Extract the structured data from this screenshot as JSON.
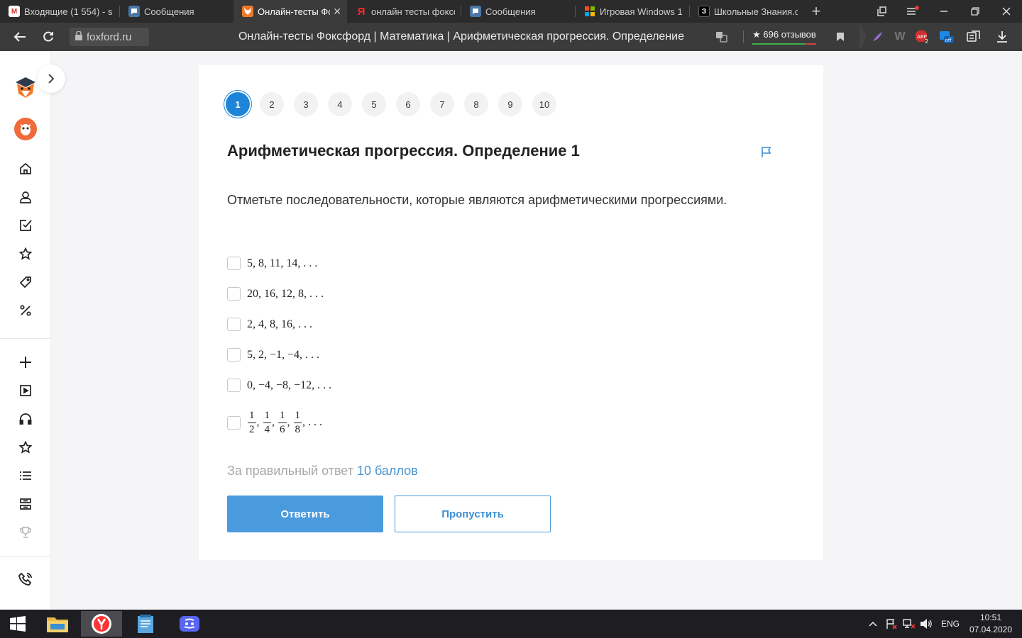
{
  "browser": {
    "tabs": [
      {
        "title": "Входящие (1 554) - s",
        "favicon": "gmail-icon",
        "color": "#d93025",
        "glyph": "M",
        "active": false
      },
      {
        "title": "Сообщения",
        "favicon": "vk-messages-icon",
        "color": "#4a76a8",
        "glyph": "",
        "active": false
      },
      {
        "title": "Онлайн-тесты Фо",
        "favicon": "foxford-icon",
        "color": "#f07a2c",
        "glyph": "",
        "active": true
      },
      {
        "title": "онлайн тесты фоксф",
        "favicon": "yandex-icon",
        "color": "#3b3b3b",
        "glyph": "Я",
        "active": false
      },
      {
        "title": "Сообщения",
        "favicon": "vk-messages-icon",
        "color": "#4a76a8",
        "glyph": "",
        "active": false
      },
      {
        "title": "Игровая Windows 1",
        "favicon": "microsoft-icon",
        "color": "#3b3b3b",
        "glyph": "",
        "active": false
      },
      {
        "title": "Школьные Знания.c",
        "favicon": "znanija-icon",
        "color": "#111111",
        "glyph": "З",
        "active": false
      }
    ],
    "url": "foxford.ru",
    "page_title": "Онлайн-тесты Фоксфорд | Математика | Арифметическая прогрессия. Определение",
    "reviews": "★ 696 отзывов"
  },
  "sidebar": {
    "items": [
      "home-icon",
      "profile-icon",
      "tasks-icon",
      "favorites-icon",
      "tag-icon",
      "discount-icon",
      "add-icon",
      "video-icon",
      "headphones-icon",
      "star-icon",
      "list-icon",
      "archive-icon",
      "trophy-icon",
      "phone-icon"
    ]
  },
  "quiz": {
    "question_numbers": [
      "1",
      "2",
      "3",
      "4",
      "5",
      "6",
      "7",
      "8",
      "9",
      "10"
    ],
    "current": "1",
    "title": "Арифметическая прогрессия. Определение 1",
    "question": "Отметьте последовательности, которые являются арифметическими прогрессиями.",
    "options": [
      "5, 8, 11, 14, . . .",
      "20, 16, 12, 8, . . .",
      "2, 4, 8, 16, . . .",
      "5, 2, −1, −4, . . .",
      "0, −4, −8, −12, . . ."
    ],
    "fraction_option": {
      "numerators": [
        "1",
        "1",
        "1",
        "1"
      ],
      "denominators": [
        "2",
        "4",
        "6",
        "8"
      ],
      "tail": ", . . ."
    },
    "points_prefix": "За правильный ответ",
    "points_value": "10 баллов",
    "answer_button": "Ответить",
    "skip_button": "Пропустить"
  },
  "taskbar": {
    "apps": [
      "file-explorer-icon",
      "yandex-browser-icon",
      "notepad-icon",
      "discord-icon"
    ],
    "language": "ENG",
    "time": "10:51",
    "date": "07.04.2020"
  },
  "colors": {
    "accent": "#4a9bdd",
    "active_question": "#1d84d8",
    "fox_orange": "#f07a2c"
  }
}
